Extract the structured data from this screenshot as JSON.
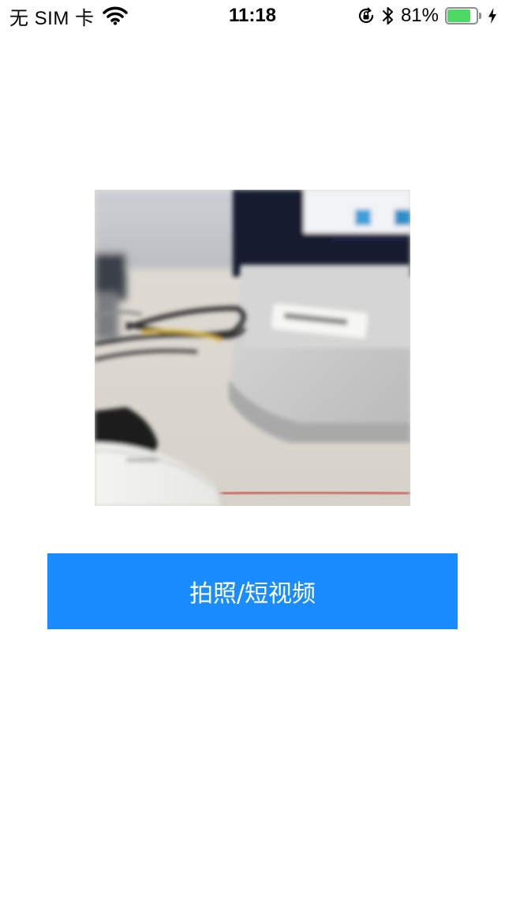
{
  "status_bar": {
    "carrier": "无 SIM 卡",
    "time": "11:18",
    "battery_percent_label": "81%",
    "battery_level": 0.81,
    "icons": [
      "wifi-icon",
      "orientation-lock-icon",
      "bluetooth-icon",
      "battery-icon",
      "charging-bolt-icon"
    ],
    "colors": {
      "battery_fill": "#4cd964",
      "battery_outline": "#8e8e93"
    }
  },
  "photo_preview": {
    "content": "blurred-photo"
  },
  "capture_button": {
    "label": "拍照/短视频",
    "background": "#1a8cff",
    "text_color": "#ffffff"
  }
}
